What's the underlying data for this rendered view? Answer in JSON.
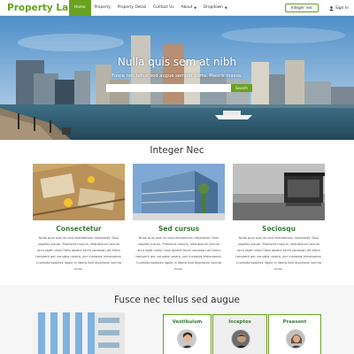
{
  "brand": "Property Land",
  "nav": {
    "items": [
      {
        "label": "Home",
        "active": true
      },
      {
        "label": "Property",
        "active": false
      },
      {
        "label": "Property Detail",
        "active": false
      },
      {
        "label": "Contact Us",
        "active": false
      },
      {
        "label": "About",
        "active": false,
        "caret": true
      },
      {
        "label": "Dropdown",
        "active": false,
        "caret": true
      }
    ],
    "button_label": "Integer nec",
    "signin_label": "Sign In"
  },
  "hero": {
    "title": "Nulla quis sem at nibh",
    "subtitle": "Fusce nec tellus sed augue semper porta. Mauris massa.",
    "search_placeholder": "",
    "search_button": "Search"
  },
  "section1": {
    "title": "Integer Nec",
    "cards": [
      {
        "title": "Consectetur",
        "text": "Nulla quis sem at nibh elementum imperdiet. Duis sagittis ipsum. Praesent mauris. Vestibulum lacinia arcu eget nulla.Class aptent taciti sociosqu ad litora torquent per conubia nostra, per inceptos himenaeos. Curabitursodales ligula in libero.Sed dignissim lacinia nunc."
      },
      {
        "title": "Sed cursus",
        "text": "Nulla quis sem at nibh elementum imperdiet. Duis sagittis ipsum. Praesent mauris. Vestibulum lacinia arcu eget nulla.Class aptent taciti sociosqu ad litora torquent per conubia nostra, per inceptos himenaeos. Curabitursodales ligula in libero.Sed dignissim lacinia nunc."
      },
      {
        "title": "Sociosqu",
        "text": "Nulla quis sem at nibh elementum imperdiet. Duis sagittis ipsum. Praesent mauris. Vestibulum lacinia arcu eget nulla.Class aptent taciti sociosqu ad litora torquent per conubia nostra, per inceptos himenaeos. Curabitursodales ligula in libero.Sed dignissim lacinia nunc."
      }
    ]
  },
  "section2": {
    "title": "Fusce nec tellus sed augue",
    "tabs": [
      {
        "label": "Vestibulum"
      },
      {
        "label": "Inceptos"
      },
      {
        "label": "Praesent"
      }
    ]
  },
  "colors": {
    "accent": "#6aa121",
    "heading_green": "#3a7a3a"
  }
}
